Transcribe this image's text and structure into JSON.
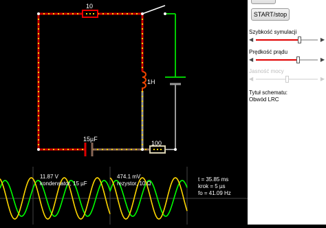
{
  "circuit": {
    "resistor_top_label": "10",
    "inductor_label": "1H",
    "capacitor_label": "15µF",
    "resistor_bottom_label": "100"
  },
  "scope": {
    "capacitor_readout": {
      "value": "11.87 V",
      "name": "kondensator, 15 µF"
    },
    "resistor_readout": {
      "value": "474.1 mV",
      "name": "rezystor, 10 Ω"
    },
    "timing": {
      "t": "t = 35.85 ms",
      "step": "krok = 5 µs",
      "fo": "fo = 41.09 Hz"
    }
  },
  "panel": {
    "start_stop_label": "START/stop",
    "simulation_speed": {
      "label": "Szybkość symulacji",
      "level": 0.7
    },
    "current_speed": {
      "label": "Prędkość prądu",
      "level": 0.68
    },
    "power_brightness": {
      "label": "Jasność mocy",
      "level": 0.5,
      "disabled": true
    },
    "schematic_title_label": "Tytuł schematu:",
    "schematic_title": "Obwód LRC"
  },
  "colors": {
    "current_dot": "#ffd200",
    "wire_positive": "#dd0000",
    "wire_neutral": "#9a9a9a",
    "wire_ground": "#00cc00",
    "trace_green": "#00ff00",
    "trace_yellow": "#ffd700"
  }
}
